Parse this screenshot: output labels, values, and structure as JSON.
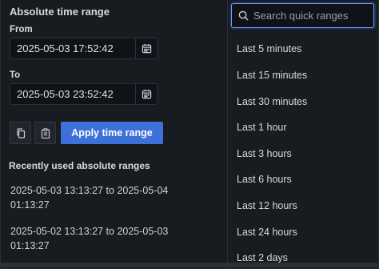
{
  "left": {
    "title": "Absolute time range",
    "from_label": "From",
    "from_value": "2025-05-03 17:52:42",
    "to_label": "To",
    "to_value": "2025-05-03 23:52:42",
    "apply_label": "Apply time range",
    "recent_title": "Recently used absolute ranges",
    "recent": [
      {
        "line1": "2025-05-03 13:13:27 to 2025-05-04",
        "line2": "01:13:27"
      },
      {
        "line1": "2025-05-02 13:13:27 to 2025-05-03",
        "line2": "01:13:27"
      }
    ]
  },
  "right": {
    "search_placeholder": "Search quick ranges",
    "quick_ranges": [
      "Last 5 minutes",
      "Last 15 minutes",
      "Last 30 minutes",
      "Last 1 hour",
      "Last 3 hours",
      "Last 6 hours",
      "Last 12 hours",
      "Last 24 hours",
      "Last 2 days"
    ]
  },
  "icons": {
    "calendar": "calendar-icon",
    "copy": "copy-icon",
    "paste": "clipboard-icon",
    "search": "search-icon"
  },
  "colors": {
    "accent": "#3d71d9",
    "background": "#181b1f",
    "input_bg": "#111217",
    "focus_border": "#6e9fff"
  }
}
